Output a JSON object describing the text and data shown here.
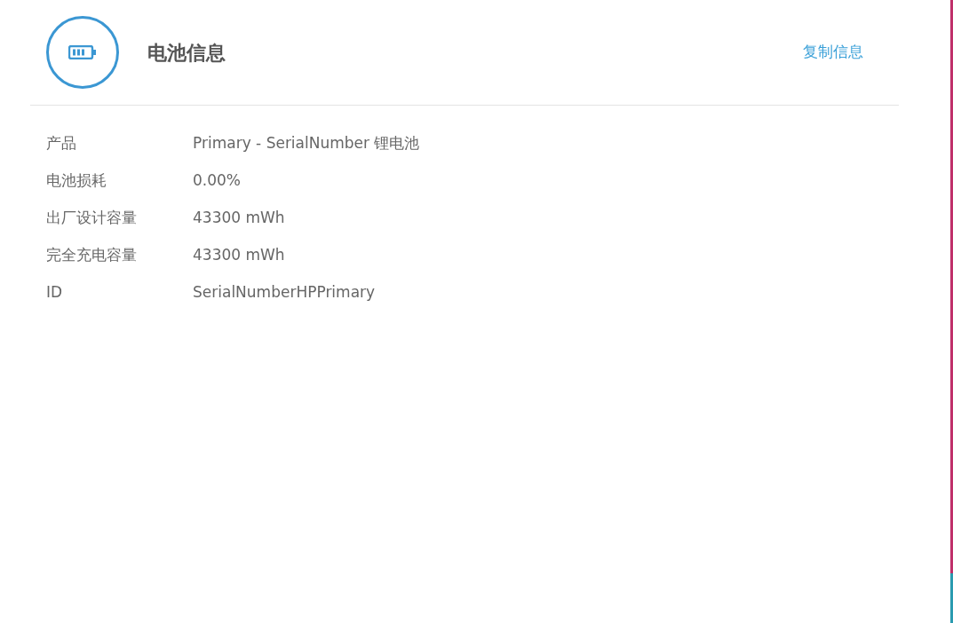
{
  "header": {
    "title": "电池信息",
    "copy_link": "复制信息"
  },
  "properties": [
    {
      "label": "产品",
      "value": "Primary - SerialNumber 锂电池"
    },
    {
      "label": "电池损耗",
      "value": "0.00%"
    },
    {
      "label": "出厂设计容量",
      "value": "43300 mWh"
    },
    {
      "label": "完全充电容量",
      "value": "43300 mWh"
    },
    {
      "label": "ID",
      "value": "SerialNumberHPPrimary"
    }
  ]
}
